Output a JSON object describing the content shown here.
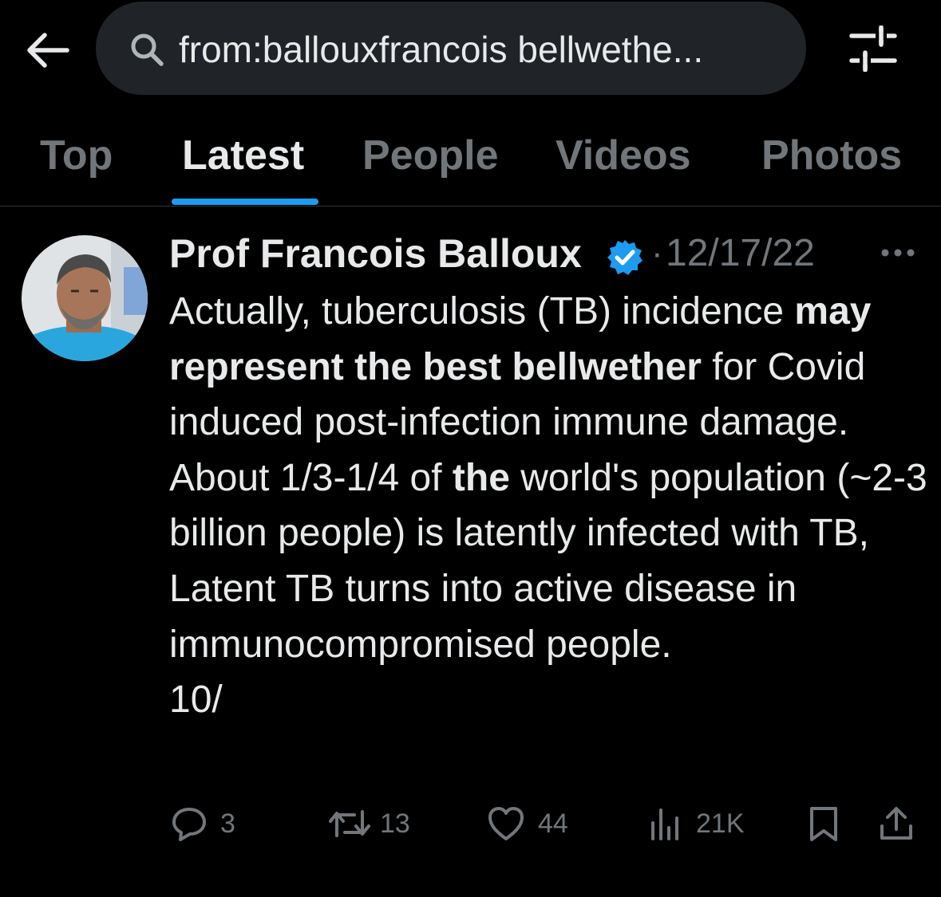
{
  "search": {
    "query": "from:ballouxfrancois bellwethe..."
  },
  "icons": {
    "back": "arrow-left-icon",
    "search": "search-icon",
    "filter": "filter-sliders-icon",
    "verified": "verified-badge-icon",
    "more": "more-horizontal-icon",
    "reply": "reply-icon",
    "retweet": "retweet-icon",
    "like": "heart-icon",
    "views": "views-icon",
    "bookmark": "bookmark-icon",
    "share": "share-icon"
  },
  "tabs": [
    {
      "label": "Top"
    },
    {
      "label": "Latest",
      "active": true
    },
    {
      "label": "People"
    },
    {
      "label": "Videos"
    },
    {
      "label": "Photos"
    }
  ],
  "tweet": {
    "author_name": "Prof Francois Balloux",
    "separator": "·",
    "date": "12/17/22",
    "text": {
      "seg1": "Actually, tuberculosis (TB) incidence ",
      "bold1": "may represent the best bellwether",
      "seg2": " for Covid induced post-infection immune damage. About 1/3-1/4 of ",
      "bold2": "the",
      "seg3": " world's population (~2-3 billion people) is latently infected with TB, Latent TB turns into active disease in immunocompromised people.",
      "seg4": "10/"
    },
    "stats": {
      "replies": "3",
      "retweets": "13",
      "likes": "44",
      "views": "21K"
    }
  },
  "colors": {
    "background": "#000000",
    "text_primary": "#e7e9ea",
    "text_secondary": "#71767b",
    "accent": "#1d9bf0",
    "search_bg": "#202327"
  }
}
